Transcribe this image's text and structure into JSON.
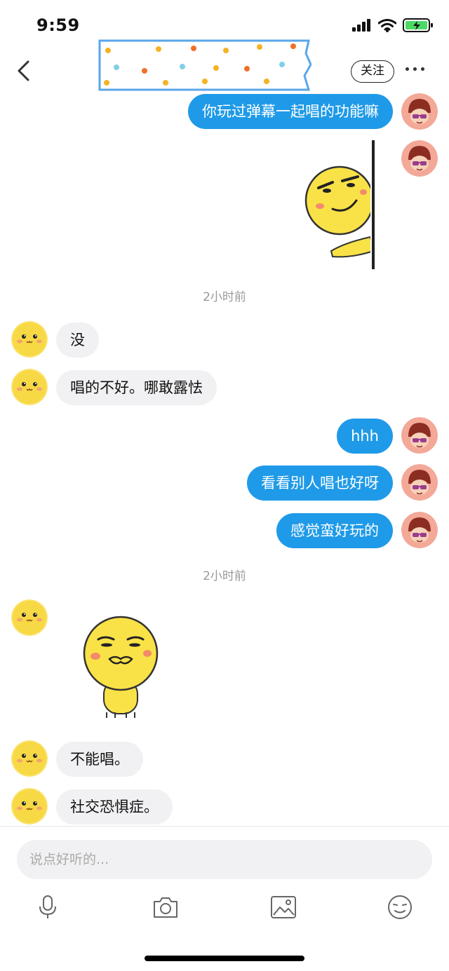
{
  "status_bar": {
    "time": "9:59"
  },
  "header": {
    "follow_label": "关注"
  },
  "timestamps": [
    "2小时前",
    "2小时前"
  ],
  "messages": [
    {
      "side": "out",
      "text": "你玩过弹幕一起唱的功能嘛"
    },
    {
      "side": "out",
      "type": "sticker",
      "sticker": "peeking-smirk-emoji"
    },
    {
      "side": "in",
      "text": "没"
    },
    {
      "side": "in",
      "text": "唱的不好。哪敢露怯"
    },
    {
      "side": "out",
      "text": "hhh"
    },
    {
      "side": "out",
      "text": "看看别人唱也好呀"
    },
    {
      "side": "out",
      "text": "感觉蛮好玩的"
    },
    {
      "side": "in",
      "type": "sticker",
      "sticker": "pouting-emoji"
    },
    {
      "side": "in",
      "text": "不能唱。"
    },
    {
      "side": "in",
      "text": "社交恐惧症。"
    }
  ],
  "composer": {
    "placeholder": "说点好听的..."
  },
  "toolbar": [
    "mic-icon",
    "camera-icon",
    "image-icon",
    "emoji-icon"
  ],
  "colors": {
    "outgoing_bubble": "#1f9ae8",
    "incoming_bubble": "#f1f1f3",
    "timestamp": "#999999"
  }
}
